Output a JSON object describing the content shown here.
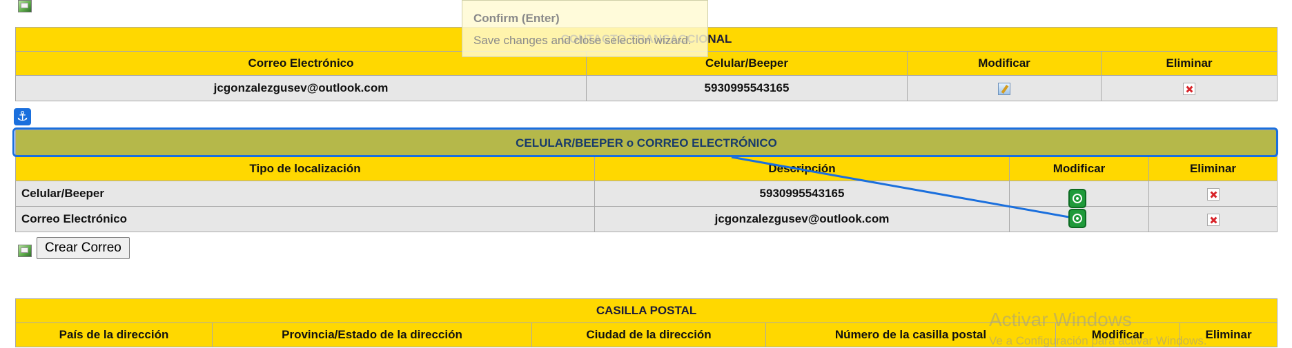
{
  "tooltip": {
    "title": "Confirm (Enter)",
    "text": "Save changes and close selection wizard."
  },
  "contacto": {
    "title": "CONTACTO TRANSACCIONAL",
    "headers": [
      "Correo Electrónico",
      "Celular/Beeper",
      "Modificar",
      "Eliminar"
    ],
    "row": {
      "email": "jcgonzalezgusev@outlook.com",
      "phone": "5930995543165"
    }
  },
  "anchor_icon": "anchor-icon",
  "celular": {
    "title": "CELULAR/BEEPER o CORREO ELECTRÓNICO",
    "headers": [
      "Tipo de localización",
      "Descripción",
      "Modificar",
      "Eliminar"
    ],
    "rows": [
      {
        "tipo": "Celular/Beeper",
        "descripcion": "5930995543165"
      },
      {
        "tipo": "Correo Electrónico",
        "descripcion": "jcgonzalezgusev@outlook.com"
      }
    ]
  },
  "crear_correo_label": "Crear Correo",
  "casilla": {
    "title": "CASILLA POSTAL",
    "headers": [
      "País de la dirección",
      "Provincia/Estado de la dirección",
      "Ciudad de la dirección",
      "Número de la casilla postal",
      "Modificar",
      "Eliminar"
    ]
  },
  "watermark": {
    "line1": "Activar Windows",
    "line2": "Ve a Configuración para activar Windows."
  },
  "colors": {
    "header_yellow": "#ffd800",
    "row_gray": "#e7e7e7",
    "olive": "#b5b84a",
    "selection_blue": "#1a6fdd"
  }
}
